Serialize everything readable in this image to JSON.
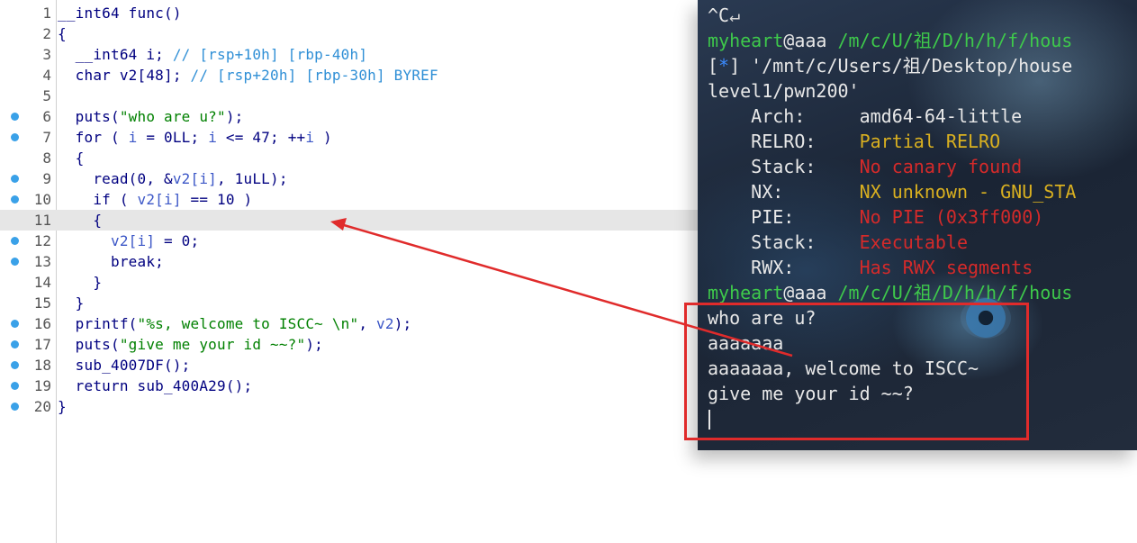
{
  "code": {
    "lines": [
      {
        "n": "1",
        "bp": false,
        "html": "<span class=\"k\">__int64 func()</span>"
      },
      {
        "n": "2",
        "bp": false,
        "html": "<span class=\"k\">{</span>"
      },
      {
        "n": "3",
        "bp": false,
        "html": "  <span class=\"k\">__int64 i; </span><span class=\"c\">// [rsp+10h] [rbp-40h]</span>"
      },
      {
        "n": "4",
        "bp": false,
        "html": "  <span class=\"k\">char v2[48]; </span><span class=\"c\">// [rsp+20h] [rbp-30h] BYREF</span>"
      },
      {
        "n": "5",
        "bp": false,
        "html": ""
      },
      {
        "n": "6",
        "bp": true,
        "html": "  <span class=\"k\">puts(</span><span class=\"s\">\"who are u?\"</span><span class=\"k\">);</span>"
      },
      {
        "n": "7",
        "bp": true,
        "html": "  <span class=\"k\">for ( </span><span class=\"v\">i</span><span class=\"k\"> = 0LL; </span><span class=\"v\">i</span><span class=\"k\"> &lt;= 47; ++</span><span class=\"v\">i</span><span class=\"k\"> )</span>"
      },
      {
        "n": "8",
        "bp": false,
        "html": "  <span class=\"k\">{</span>"
      },
      {
        "n": "9",
        "bp": true,
        "html": "    <span class=\"k\">read(0, &amp;</span><span class=\"v\">v2[i]</span><span class=\"k\">, 1uLL);</span>"
      },
      {
        "n": "10",
        "bp": true,
        "html": "    <span class=\"k\">if ( </span><span class=\"v\">v2[i]</span><span class=\"k\"> == 10 )</span>"
      },
      {
        "n": "11",
        "bp": false,
        "html": "    <span class=\"k\">{</span>"
      },
      {
        "n": "12",
        "bp": true,
        "html": "      <span class=\"v\">v2[i]</span><span class=\"k\"> = 0;</span>"
      },
      {
        "n": "13",
        "bp": true,
        "html": "      <span class=\"k\">break;</span>"
      },
      {
        "n": "14",
        "bp": false,
        "html": "    <span class=\"k\">}</span>"
      },
      {
        "n": "15",
        "bp": false,
        "html": "  <span class=\"k\">}</span>"
      },
      {
        "n": "16",
        "bp": true,
        "html": "  <span class=\"k\">printf(</span><span class=\"s\">\"%s, welcome to ISCC~ \\n\"</span><span class=\"k\">, </span><span class=\"v\">v2</span><span class=\"k\">);</span>"
      },
      {
        "n": "17",
        "bp": true,
        "html": "  <span class=\"k\">puts(</span><span class=\"s\">\"give me your id ~~?\"</span><span class=\"k\">);</span>"
      },
      {
        "n": "18",
        "bp": true,
        "html": "  <span class=\"k\">sub_4007DF();</span>"
      },
      {
        "n": "19",
        "bp": true,
        "html": "  <span class=\"k\">return sub_400A29();</span>"
      },
      {
        "n": "20",
        "bp": true,
        "html": "<span class=\"k\">}</span>"
      }
    ],
    "highlight_line": "11"
  },
  "terminal": {
    "lines": [
      {
        "html": "<span class=\"w\">^C</span><span class=\"d\">↵</span>"
      },
      {
        "html": "<span class=\"g\">myheart</span><span class=\"w\">@aaa </span><span class=\"g\">/m/c/U/祖/D/h/h/f/hous</span>"
      },
      {
        "html": "<span class=\"w\">[</span><span class=\"b\">*</span><span class=\"w\">] '/mnt/c/Users/祖/Desktop/house</span>"
      },
      {
        "html": "<span class=\"w\">level1/pwn200'</span>"
      },
      {
        "html": "<span class=\"w\">    Arch:     amd64-64-little</span>"
      },
      {
        "html": "<span class=\"w\">    RELRO:    </span><span class=\"y\">Partial RELRO</span>"
      },
      {
        "html": "<span class=\"w\">    Stack:    </span><span class=\"r\">No canary found</span>"
      },
      {
        "html": "<span class=\"w\">    NX:       </span><span class=\"y\">NX unknown - GNU_STA</span>"
      },
      {
        "html": "<span class=\"w\">    PIE:      </span><span class=\"r\">No PIE (0x3ff000)</span>"
      },
      {
        "html": "<span class=\"w\">    Stack:    </span><span class=\"r\">Executable</span>"
      },
      {
        "html": "<span class=\"w\">    RWX:      </span><span class=\"r\">Has RWX segments</span>"
      },
      {
        "html": "<span class=\"g\">myheart</span><span class=\"w\">@aaa </span><span class=\"g\">/m/c/U/祖/D/h/h/f/hous</span>"
      },
      {
        "html": "<span class=\"w\">who are u?</span>"
      },
      {
        "html": "<span class=\"w\">aaaaaaa</span>"
      },
      {
        "html": "<span class=\"w\">aaaaaaa, welcome to ISCC~</span>"
      },
      {
        "html": "<span class=\"w\">give me your id ~~?</span>"
      }
    ]
  },
  "colors": {
    "annotation_red": "#e02b2b",
    "breakpoint_blue": "#3aa1e8",
    "prompt_green": "#3ec94b"
  }
}
